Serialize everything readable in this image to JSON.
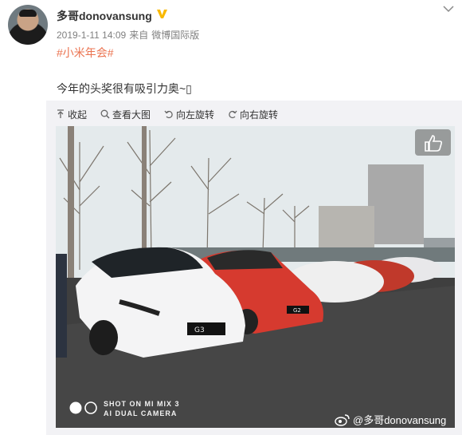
{
  "post": {
    "username": "多哥donovansung",
    "timestamp": "2019-1-11 14:09",
    "source_prefix": "来自",
    "source": "微博国际版",
    "hashtag": "#小米年会#",
    "content": "今年的头奖很有吸引力奥~▯"
  },
  "toolbar": {
    "collapse": "收起",
    "view_large": "查看大图",
    "rotate_left": "向左旋转",
    "rotate_right": "向右旋转"
  },
  "photo": {
    "shot_line1": "SHOT ON MI MIX 3",
    "shot_line2": "AI DUAL CAMERA",
    "watermark": "@多哥donovansung",
    "car_plates": [
      "G3",
      "G2"
    ]
  },
  "icons": {
    "verified": "verified-v-badge-icon",
    "more": "chevron-down-icon",
    "like": "thumbs-up-icon",
    "weibo": "weibo-logo-icon"
  },
  "colors": {
    "hashtag": "#eb7350",
    "verified": "#f9b900",
    "panel": "#f2f2f5"
  }
}
